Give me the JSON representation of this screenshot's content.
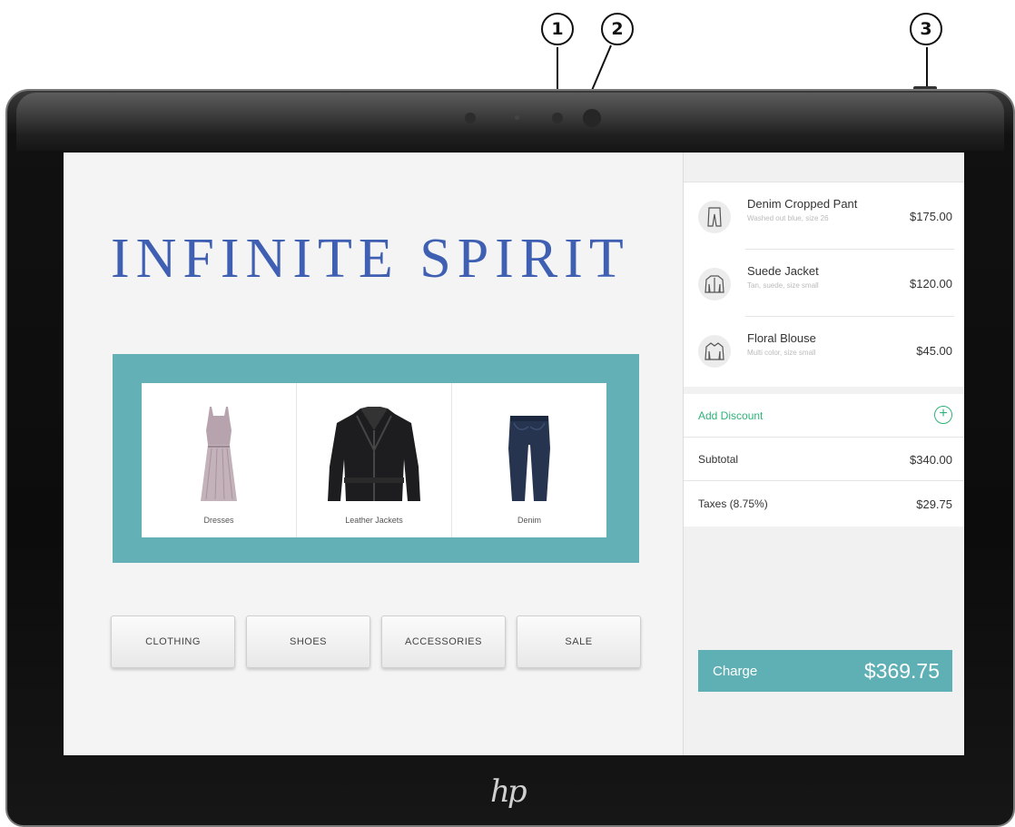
{
  "callouts": [
    "1",
    "2",
    "3"
  ],
  "device": {
    "logo": "hp"
  },
  "store": {
    "brand": "INFINITE SPIRIT"
  },
  "featured": [
    {
      "label": "Dresses",
      "icon": "dress-icon"
    },
    {
      "label": "Leather Jackets",
      "icon": "leather-jacket-icon"
    },
    {
      "label": "Denim",
      "icon": "jeans-icon"
    }
  ],
  "categories": [
    "CLOTHING",
    "SHOES",
    "ACCESSORIES",
    "SALE"
  ],
  "cart": {
    "items": [
      {
        "name": "Denim Cropped Pant",
        "desc": "Washed out blue, size 26",
        "price": "$175.00",
        "icon": "pants-icon"
      },
      {
        "name": "Suede Jacket",
        "desc": "Tan, suede, size small",
        "price": "$120.00",
        "icon": "jacket-icon"
      },
      {
        "name": "Floral Blouse",
        "desc": "Multi color, size small",
        "price": "$45.00",
        "icon": "blouse-icon"
      }
    ],
    "discount_label": "Add Discount",
    "subtotal_label": "Subtotal",
    "subtotal": "$340.00",
    "taxes_label": "Taxes (8.75%)",
    "taxes": "$29.75",
    "charge_label": "Charge",
    "total": "$369.75"
  },
  "colors": {
    "brand": "#3f5fb3",
    "accent": "#63b1b6",
    "discount": "#2fb37a"
  }
}
